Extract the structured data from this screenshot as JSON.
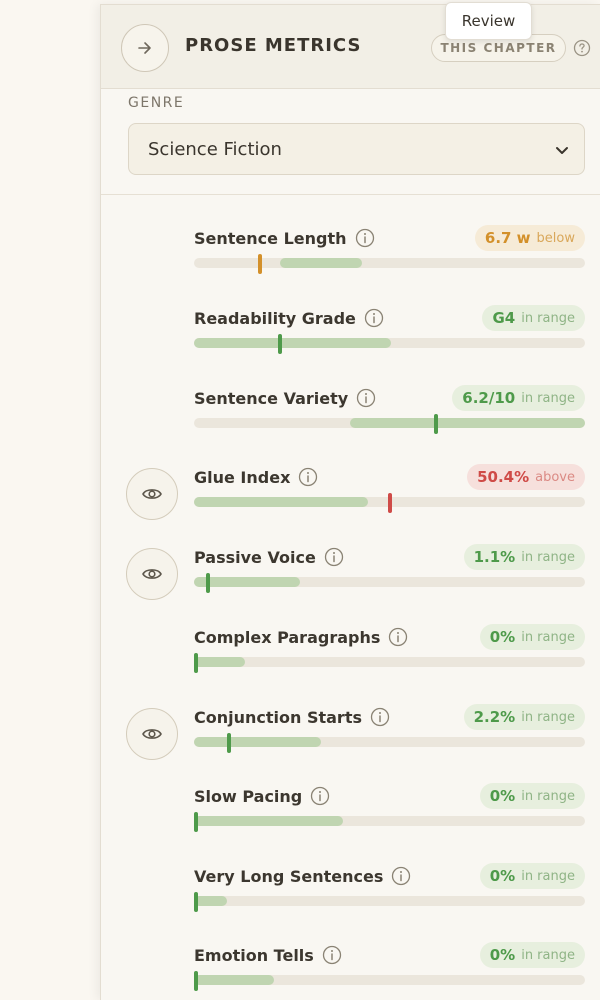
{
  "header": {
    "title": "PROSE METRICS",
    "scope_label": "THIS CHAPTER",
    "tooltip": "Review"
  },
  "genre": {
    "label": "GENRE",
    "selected": "Science Fiction"
  },
  "colors": {
    "in_range": "#4e9a4a",
    "below": "#d3902a",
    "above": "#cf4b47",
    "band": "#c0d5b1"
  },
  "icons": {
    "collapse": "arrow-right-icon",
    "help": "help-circle-icon",
    "info": "info-icon",
    "eye": "eye-icon",
    "select": "chevron-down-icon"
  },
  "metrics": [
    {
      "name": "Sentence Length",
      "value": "6.7 w",
      "status": "below",
      "eye": false,
      "band": [
        0.22,
        0.43
      ],
      "marker": 0.17
    },
    {
      "name": "Readability Grade",
      "value": "G4",
      "status": "in range",
      "eye": false,
      "band": [
        0.0,
        0.505
      ],
      "marker": 0.22
    },
    {
      "name": "Sentence Variety",
      "value": "6.2/10",
      "status": "in range",
      "eye": false,
      "band": [
        0.4,
        1.0
      ],
      "marker": 0.62
    },
    {
      "name": "Glue Index",
      "value": "50.4%",
      "status": "above",
      "eye": true,
      "band": [
        0.0,
        0.445
      ],
      "marker": 0.5
    },
    {
      "name": "Passive Voice",
      "value": "1.1%",
      "status": "in range",
      "eye": true,
      "band": [
        0.0,
        0.27
      ],
      "marker": 0.035
    },
    {
      "name": "Complex Paragraphs",
      "value": "0%",
      "status": "in range",
      "eye": false,
      "band": [
        0.0,
        0.13
      ],
      "marker": 0.0
    },
    {
      "name": "Conjunction Starts",
      "value": "2.2%",
      "status": "in range",
      "eye": true,
      "band": [
        0.0,
        0.325
      ],
      "marker": 0.09
    },
    {
      "name": "Slow Pacing",
      "value": "0%",
      "status": "in range",
      "eye": false,
      "band": [
        0.0,
        0.38
      ],
      "marker": 0.0
    },
    {
      "name": "Very Long Sentences",
      "value": "0%",
      "status": "in range",
      "eye": false,
      "band": [
        0.0,
        0.085
      ],
      "marker": 0.0
    },
    {
      "name": "Emotion Tells",
      "value": "0%",
      "status": "in range",
      "eye": false,
      "band": [
        0.0,
        0.205
      ],
      "marker": 0.0
    }
  ]
}
